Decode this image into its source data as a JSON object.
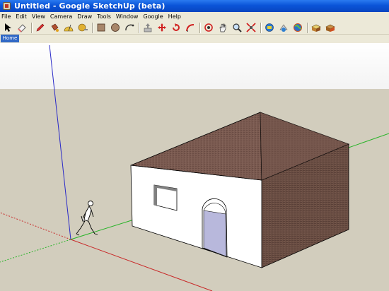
{
  "window": {
    "title": "Untitled - Google SketchUp (beta)"
  },
  "menu": [
    "File",
    "Edit",
    "View",
    "Camera",
    "Draw",
    "Tools",
    "Window",
    "Google",
    "Help"
  ],
  "toolbar": {
    "icons": [
      "select-arrow-icon",
      "eraser-icon",
      "pencil-icon",
      "paint-bucket-icon",
      "protractor-icon",
      "rectangle-icon",
      "circle-icon",
      "arc-icon",
      "push-pull-icon",
      "move-icon",
      "rotate-icon",
      "follow-me-icon",
      "orbit-icon",
      "pan-hand-icon",
      "zoom-icon",
      "zoom-extents-icon",
      "get-models-icon",
      "share-model-icon",
      "google-earth-icon",
      "components-icon",
      "materials-icon"
    ]
  },
  "tabs": [
    {
      "label": "Home",
      "active": true
    }
  ],
  "colors": {
    "titlebar": "#0a54d8",
    "sky": "#ffffff",
    "ground": "#d2cdbd",
    "axis_red": "#c82828",
    "axis_green": "#28b428",
    "axis_blue": "#2828c8",
    "roof": "#7a5a50",
    "wall_front": "#ffffff",
    "wall_side": "#6b4f44",
    "door": "#b8b8dc"
  }
}
